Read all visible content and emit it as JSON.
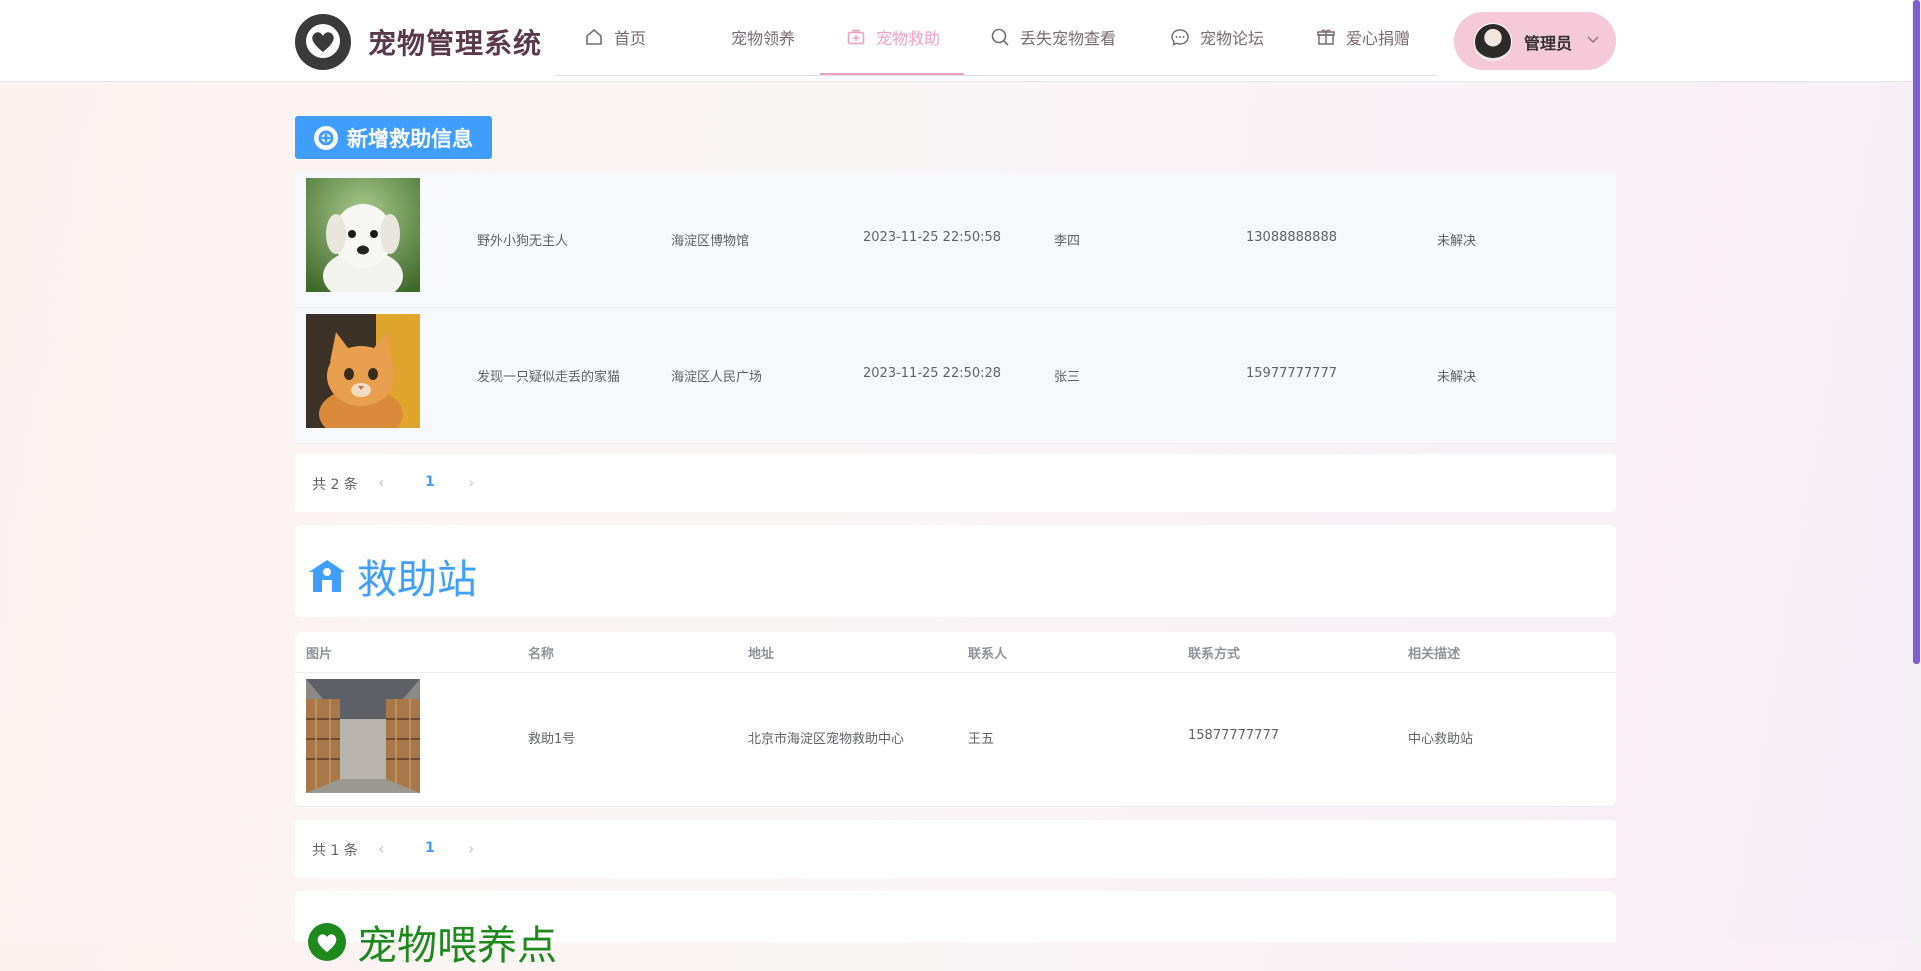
{
  "app": {
    "title": "宠物管理系统"
  },
  "nav": {
    "items": [
      {
        "label": "首页",
        "icon": "home-icon"
      },
      {
        "label": "宠物领养",
        "icon": ""
      },
      {
        "label": "宠物救助",
        "icon": "medical-kit-icon",
        "active": true
      },
      {
        "label": "丢失宠物查看",
        "icon": "search-icon"
      },
      {
        "label": "宠物论坛",
        "icon": "chat-icon"
      },
      {
        "label": "爱心捐赠",
        "icon": "gift-icon"
      }
    ]
  },
  "user": {
    "name": "管理员"
  },
  "rescue": {
    "add_button": "新增救助信息",
    "rows": [
      {
        "image": "puppy",
        "title": "野外小狗无主人",
        "location": "海淀区博物馆",
        "time": "2023-11-25 22:50:58",
        "contact": "李四",
        "phone": "13088888888",
        "status": "未解决"
      },
      {
        "image": "cat",
        "title": "发现一只疑似走丢的家猫",
        "location": "海淀区人民广场",
        "time": "2023-11-25 22:50:28",
        "contact": "张三",
        "phone": "15977777777",
        "status": "未解决"
      }
    ],
    "pager": {
      "total": "共 2 条",
      "page": "1"
    }
  },
  "station": {
    "title": "救助站",
    "headers": [
      "图片",
      "名称",
      "地址",
      "联系人",
      "联系方式",
      "相关描述"
    ],
    "rows": [
      {
        "image": "warehouse",
        "name": "救助1号",
        "address": "北京市海淀区宠物救助中心",
        "contact": "王五",
        "phone": "15877777777",
        "desc": "中心救助站"
      }
    ],
    "pager": {
      "total": "共 1 条",
      "page": "1"
    }
  },
  "feeding": {
    "title": "宠物喂养点"
  },
  "colors": {
    "accent": "#409eff",
    "nav_active": "#f29fc4",
    "user_pill": "#f5c9d8",
    "feeding_green": "#1e8a1e"
  }
}
